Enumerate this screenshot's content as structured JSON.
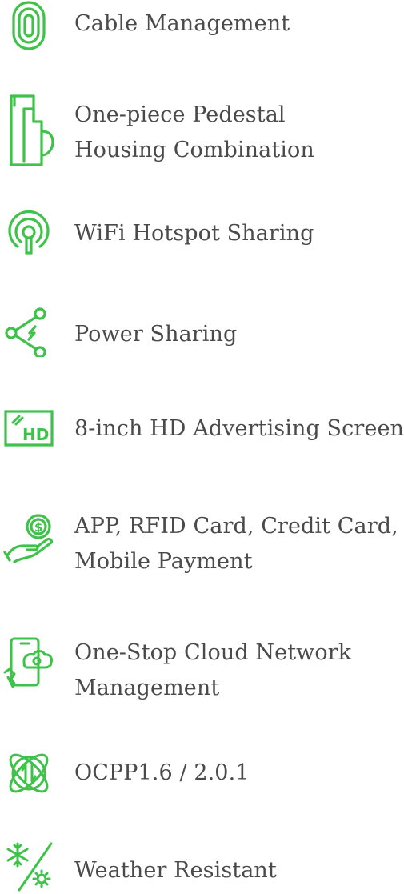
{
  "accent_color": "#3ec24a",
  "text_color": "#4a4a4a",
  "features": [
    {
      "icon": "cable-management-icon",
      "lines": [
        "Cable Management"
      ]
    },
    {
      "icon": "pedestal-housing-icon",
      "lines": [
        "One-piece Pedestal",
        "Housing Combination"
      ]
    },
    {
      "icon": "wifi-hotspot-icon",
      "lines": [
        "WiFi Hotspot Sharing"
      ]
    },
    {
      "icon": "power-sharing-icon",
      "lines": [
        "Power Sharing"
      ]
    },
    {
      "icon": "hd-screen-icon",
      "lines": [
        "8-inch HD Advertising Screen"
      ]
    },
    {
      "icon": "payment-hand-icon",
      "lines": [
        "APP, RFID Card, Credit Card,",
        "Mobile Payment"
      ]
    },
    {
      "icon": "cloud-phone-icon",
      "lines": [
        "One-Stop Cloud Network",
        "Management"
      ]
    },
    {
      "icon": "ocpp-globe-icon",
      "lines": [
        "OCPP1.6 / 2.0.1"
      ]
    },
    {
      "icon": "weather-resistant-icon",
      "lines": [
        "Weather Resistant"
      ]
    }
  ]
}
